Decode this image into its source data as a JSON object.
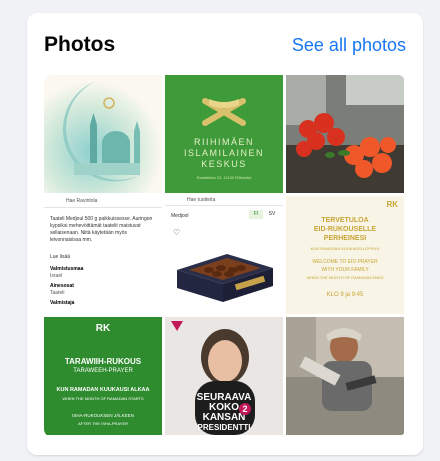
{
  "section": {
    "title": "Photos",
    "see_all_label": "See all photos"
  },
  "photos": [
    {
      "name": "mosque-crescent-watercolor"
    },
    {
      "name": "rihimaen-islamilainen-keskus",
      "lines": [
        "RIIHIMÄEN",
        "ISLAMILAINEN",
        "KESKUS"
      ],
      "small": "Rautatieka 22, 11100 Riihimäki"
    },
    {
      "name": "red-roses-bouquet"
    },
    {
      "name": "ravintola-info-screenshot",
      "top": "Hae Ravintola",
      "body": "Taateli Medjoul 500 g paikkuissesse. Auringon kypsiksi mehevöittämät taatelit maistuvat sellaisenaan. Niitä käytetään myös leivonnaisissa mm.",
      "more": "Lue lisää",
      "rows": [
        {
          "label": "Valmistusmaa",
          "value": "Israel"
        },
        {
          "label": "Ainesosat",
          "value": "Taateli"
        },
        {
          "label": "Valmistaja",
          "value": ""
        }
      ]
    },
    {
      "name": "dates-box-product-screenshot",
      "top": "Hae tuotteita",
      "label": "Medjool",
      "langs": [
        "FI",
        "SV"
      ]
    },
    {
      "name": "eid-prayer-invite",
      "logo": "RK",
      "lines": [
        "TERVETULOA",
        "EID-RUKOUSELLE",
        "PERHEINESI"
      ],
      "sub": "KUN RAMADAN KUUKAUSI LOPPUU",
      "en": [
        "WELCOME TO EID PRAYER",
        "WITH YOUR FAMILY",
        "WHEN THE MONTH OF RAMADAN ENDS"
      ],
      "kello": "KLO 9 ja 9:45"
    },
    {
      "name": "tarawih-rukous-poster",
      "logo": "RK",
      "title": "TARAWIIH-RUKOUS",
      "title_en": "TARAWEEH-PRAYER",
      "line1": "KUN RAMADAN KUUKAUSI ALKAA",
      "line1_en": "WHEN THE MONTH OF RAMADAN STARTS",
      "line2": "ISHA-RUKOUKSEN JÄLKEEN",
      "line2_en": "AFTER THE ISHA-PRAYER"
    },
    {
      "name": "election-poster-woman",
      "lines": [
        "SEURAAVA",
        "KOKO",
        "KANSAN",
        "PRESIDENTTI"
      ],
      "badge": "2"
    },
    {
      "name": "worker-cutting-stone"
    }
  ],
  "colors": {
    "accent": "#1877f2",
    "green": "#2e8b2e",
    "gold": "#d4b24c"
  }
}
